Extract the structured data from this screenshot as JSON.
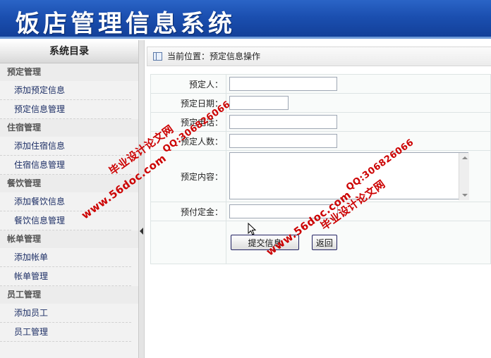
{
  "header": {
    "title": "饭店管理信息系统"
  },
  "sidebar": {
    "title": "系统目录",
    "groups": [
      {
        "label": "预定管理",
        "items": [
          {
            "label": "添加预定信息"
          },
          {
            "label": "预定信息管理"
          }
        ]
      },
      {
        "label": "住宿管理",
        "items": [
          {
            "label": "添加住宿信息"
          },
          {
            "label": "住宿信息管理"
          }
        ]
      },
      {
        "label": "餐饮管理",
        "items": [
          {
            "label": "添加餐饮信息"
          },
          {
            "label": "餐饮信息管理"
          }
        ]
      },
      {
        "label": "帐单管理",
        "items": [
          {
            "label": "添加帐单"
          },
          {
            "label": "帐单管理"
          }
        ]
      },
      {
        "label": "员工管理",
        "items": [
          {
            "label": "添加员工"
          },
          {
            "label": "员工管理"
          }
        ]
      }
    ]
  },
  "location": {
    "text": "当前位置：预定信息操作"
  },
  "form": {
    "booker_label": "预定人：",
    "booker_value": "",
    "date_label": "预定日期：",
    "date_value": "",
    "phone_label": "预定电话：",
    "phone_value": "",
    "count_label": "预定人数：",
    "count_value": "",
    "content_label": "预定内容：",
    "content_value": "",
    "deposit_label": "预付定金：",
    "deposit_value": "",
    "submit_label": "提交信息",
    "back_label": "返回"
  },
  "watermarks": {
    "site": "www.56doc.com",
    "qq": "QQ:306826066",
    "name": "毕业设计论文网"
  },
  "colors": {
    "header_blue": "#1b4fb0",
    "watermark_red": "#cc0000",
    "link_blue": "#1d2f66"
  }
}
